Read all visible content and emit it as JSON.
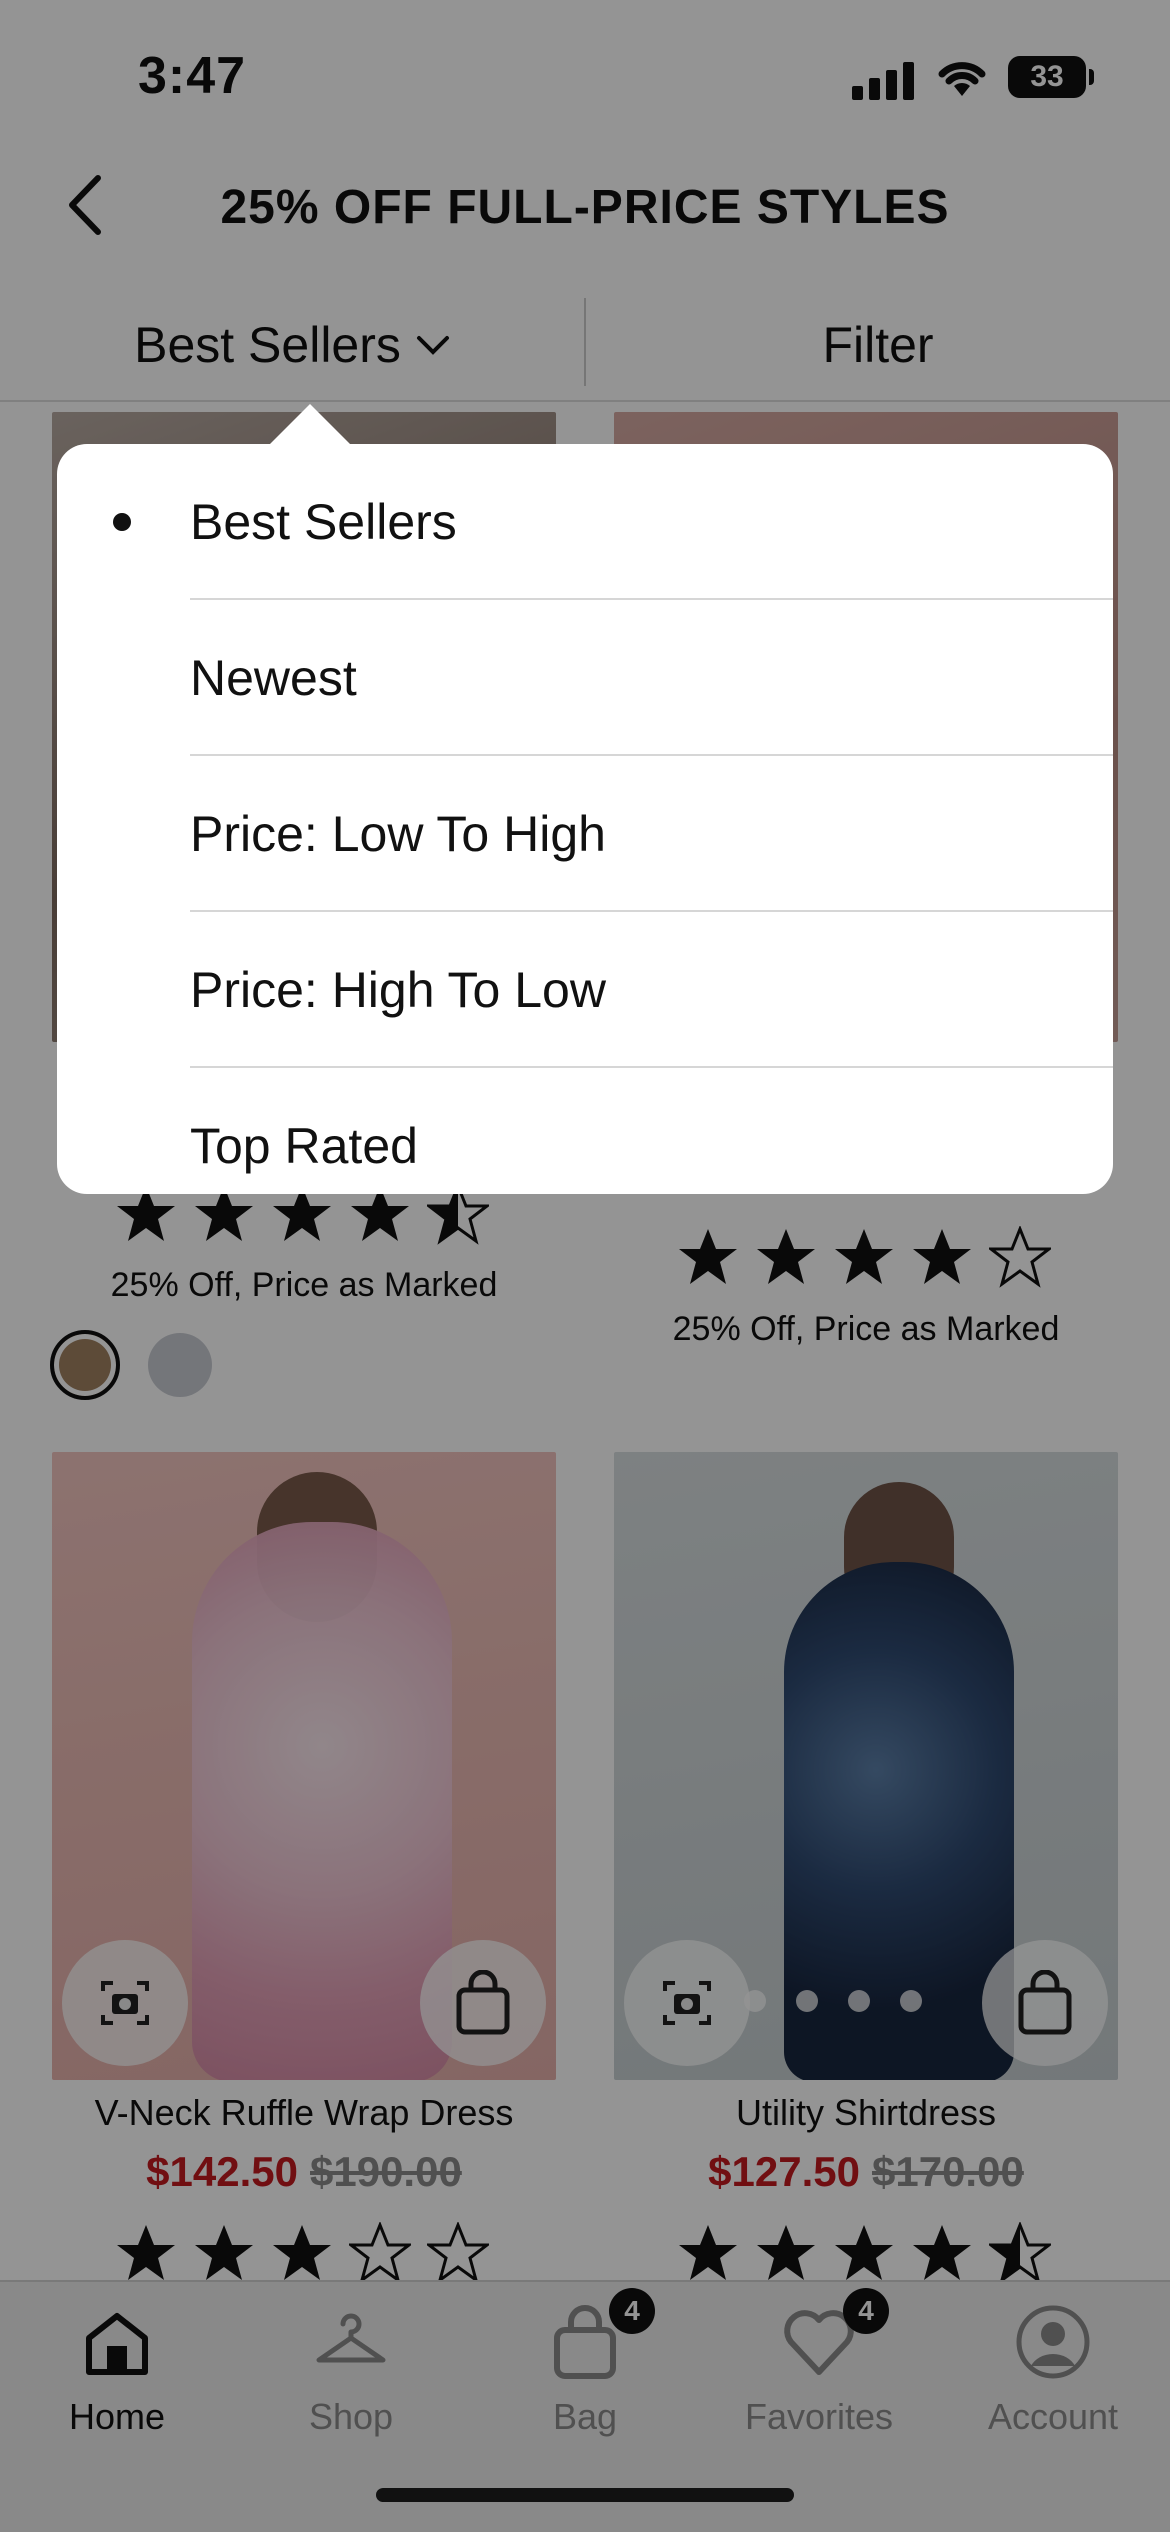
{
  "status_bar": {
    "time": "3:47",
    "battery": "33"
  },
  "header": {
    "title": "25% OFF FULL-PRICE STYLES"
  },
  "toolbar": {
    "sort_label": "Best Sellers",
    "filter_label": "Filter"
  },
  "sort_menu": {
    "selected_index": 0,
    "options": [
      "Best Sellers",
      "Newest",
      "Price: Low To High",
      "Price: High To Low",
      "Top Rated"
    ]
  },
  "products_top": [
    {
      "rating": 4.5,
      "promo": "25% Off, Price as Marked",
      "swatches": [
        "#a18161",
        "#c9ccd3"
      ]
    },
    {
      "rating": 4,
      "promo": "25% Off, Price as Marked"
    }
  ],
  "products": [
    {
      "name": "V-Neck Ruffle Wrap Dress",
      "sale_price": "$142.50",
      "original_price": "$190.00",
      "rating": 3
    },
    {
      "name": "Utility Shirtdress",
      "sale_price": "$127.50",
      "original_price": "$170.00",
      "rating": 4.5
    }
  ],
  "tabbar": {
    "items": [
      {
        "label": "Home",
        "icon": "home-icon",
        "active": true
      },
      {
        "label": "Shop",
        "icon": "hanger-icon"
      },
      {
        "label": "Bag",
        "icon": "bag-icon",
        "badge": "4"
      },
      {
        "label": "Favorites",
        "icon": "heart-icon",
        "badge": "4"
      },
      {
        "label": "Account",
        "icon": "account-icon"
      }
    ]
  },
  "colors": {
    "sale": "#c31a20",
    "overlay": "rgba(0,0,0,0.42)"
  }
}
